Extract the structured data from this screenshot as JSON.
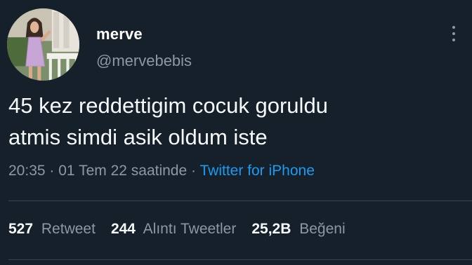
{
  "user": {
    "display_name": "merve",
    "handle": "@mervebebis"
  },
  "tweet": {
    "line1": "45 kez reddettigim cocuk goruldu",
    "line2": "atmis simdi asik oldum iste"
  },
  "meta": {
    "time": "20:35",
    "separator1": "·",
    "date": "01 Tem 22 saatinde",
    "separator2": "·",
    "source": "Twitter for iPhone"
  },
  "stats": {
    "retweets_count": "527",
    "retweets_label": "Retweet",
    "quotes_count": "244",
    "quotes_label": "Alıntı Tweetler",
    "likes_count": "25,2B",
    "likes_label": "Beğeni"
  },
  "icons": {
    "more": "more-vertical-icon"
  },
  "colors": {
    "background": "#15202b",
    "text": "#f7f9f9",
    "secondary": "#8b98a5",
    "link": "#1d9bf0",
    "divider": "#38444d"
  }
}
